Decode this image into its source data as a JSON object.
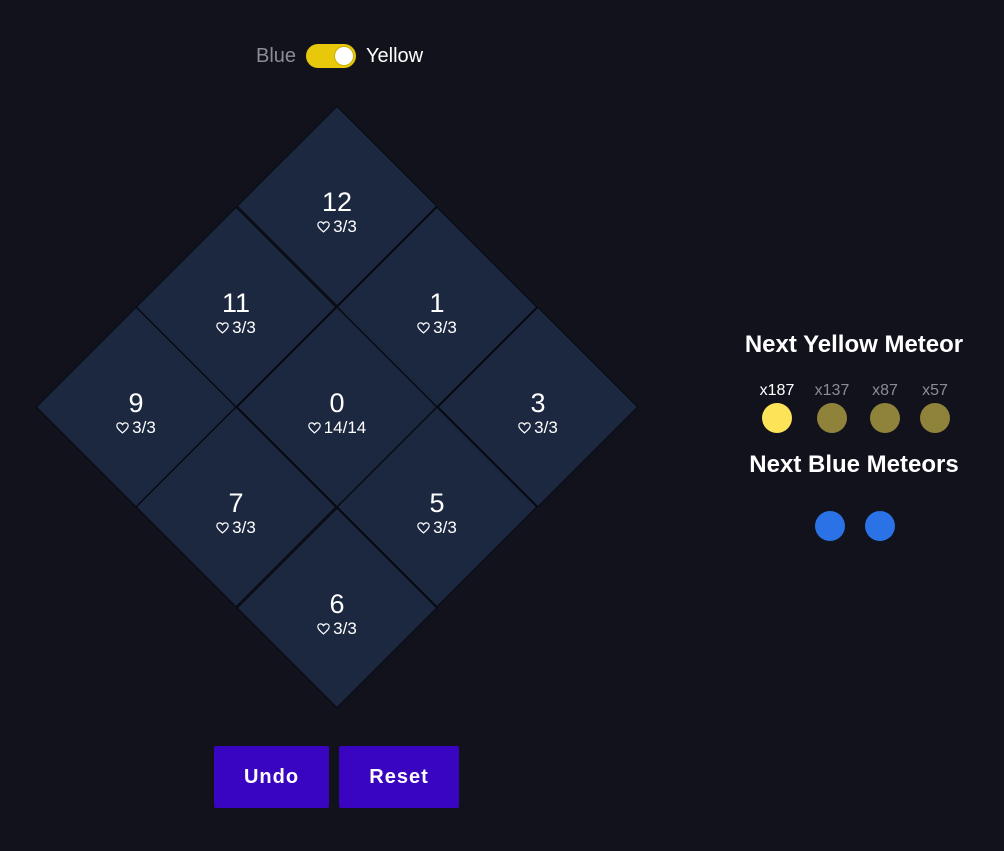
{
  "toggle": {
    "left_label": "Blue",
    "right_label": "Yellow",
    "selected": "Yellow",
    "on_color": "#e8c80a"
  },
  "board": {
    "tiles": [
      {
        "number": "12",
        "hp": "3/3"
      },
      {
        "number": "11",
        "hp": "3/3"
      },
      {
        "number": "1",
        "hp": "3/3"
      },
      {
        "number": "9",
        "hp": "3/3"
      },
      {
        "number": "0",
        "hp": "14/14"
      },
      {
        "number": "3",
        "hp": "3/3"
      },
      {
        "number": "7",
        "hp": "3/3"
      },
      {
        "number": "5",
        "hp": "3/3"
      },
      {
        "number": "6",
        "hp": "3/3"
      }
    ],
    "tile_color": "#1c2740",
    "heart_icon": "heart-outline-icon"
  },
  "buttons": {
    "undo": "Undo",
    "reset": "Reset",
    "color": "#3a05c0"
  },
  "yellow_meteor": {
    "title": "Next Yellow Meteor",
    "items": [
      {
        "mult": "x187",
        "color": "#fde357",
        "active": true
      },
      {
        "mult": "x137",
        "color": "#8f823b",
        "active": false
      },
      {
        "mult": "x87",
        "color": "#8f823b",
        "active": false
      },
      {
        "mult": "x57",
        "color": "#8f823b",
        "active": false
      }
    ]
  },
  "blue_meteors": {
    "title": "Next Blue Meteors",
    "items": [
      {
        "color": "#2a72e5"
      },
      {
        "color": "#2a72e5"
      }
    ]
  }
}
